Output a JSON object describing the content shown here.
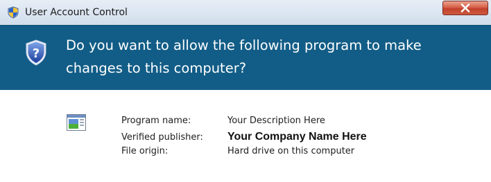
{
  "window": {
    "title": "User Account Control",
    "title_icon": "uac-shield-icon",
    "close_icon": "close-x-icon"
  },
  "banner": {
    "icon": "question-shield-icon",
    "question": "Do you want to allow the following program to make changes to this computer?"
  },
  "details": {
    "program_icon": "program-window-icon",
    "rows": [
      {
        "label": "Program name:",
        "value": "Your Description Here"
      },
      {
        "label": "Verified publisher:",
        "value": "Your Company Name Here"
      },
      {
        "label": "File origin:",
        "value": "Hard drive on this computer"
      }
    ]
  },
  "colors": {
    "banner_bg": "#125d87",
    "titlebar_bg": "#dbe5f1",
    "close_button": "#c2412c",
    "body_bg": "#ffffff"
  }
}
